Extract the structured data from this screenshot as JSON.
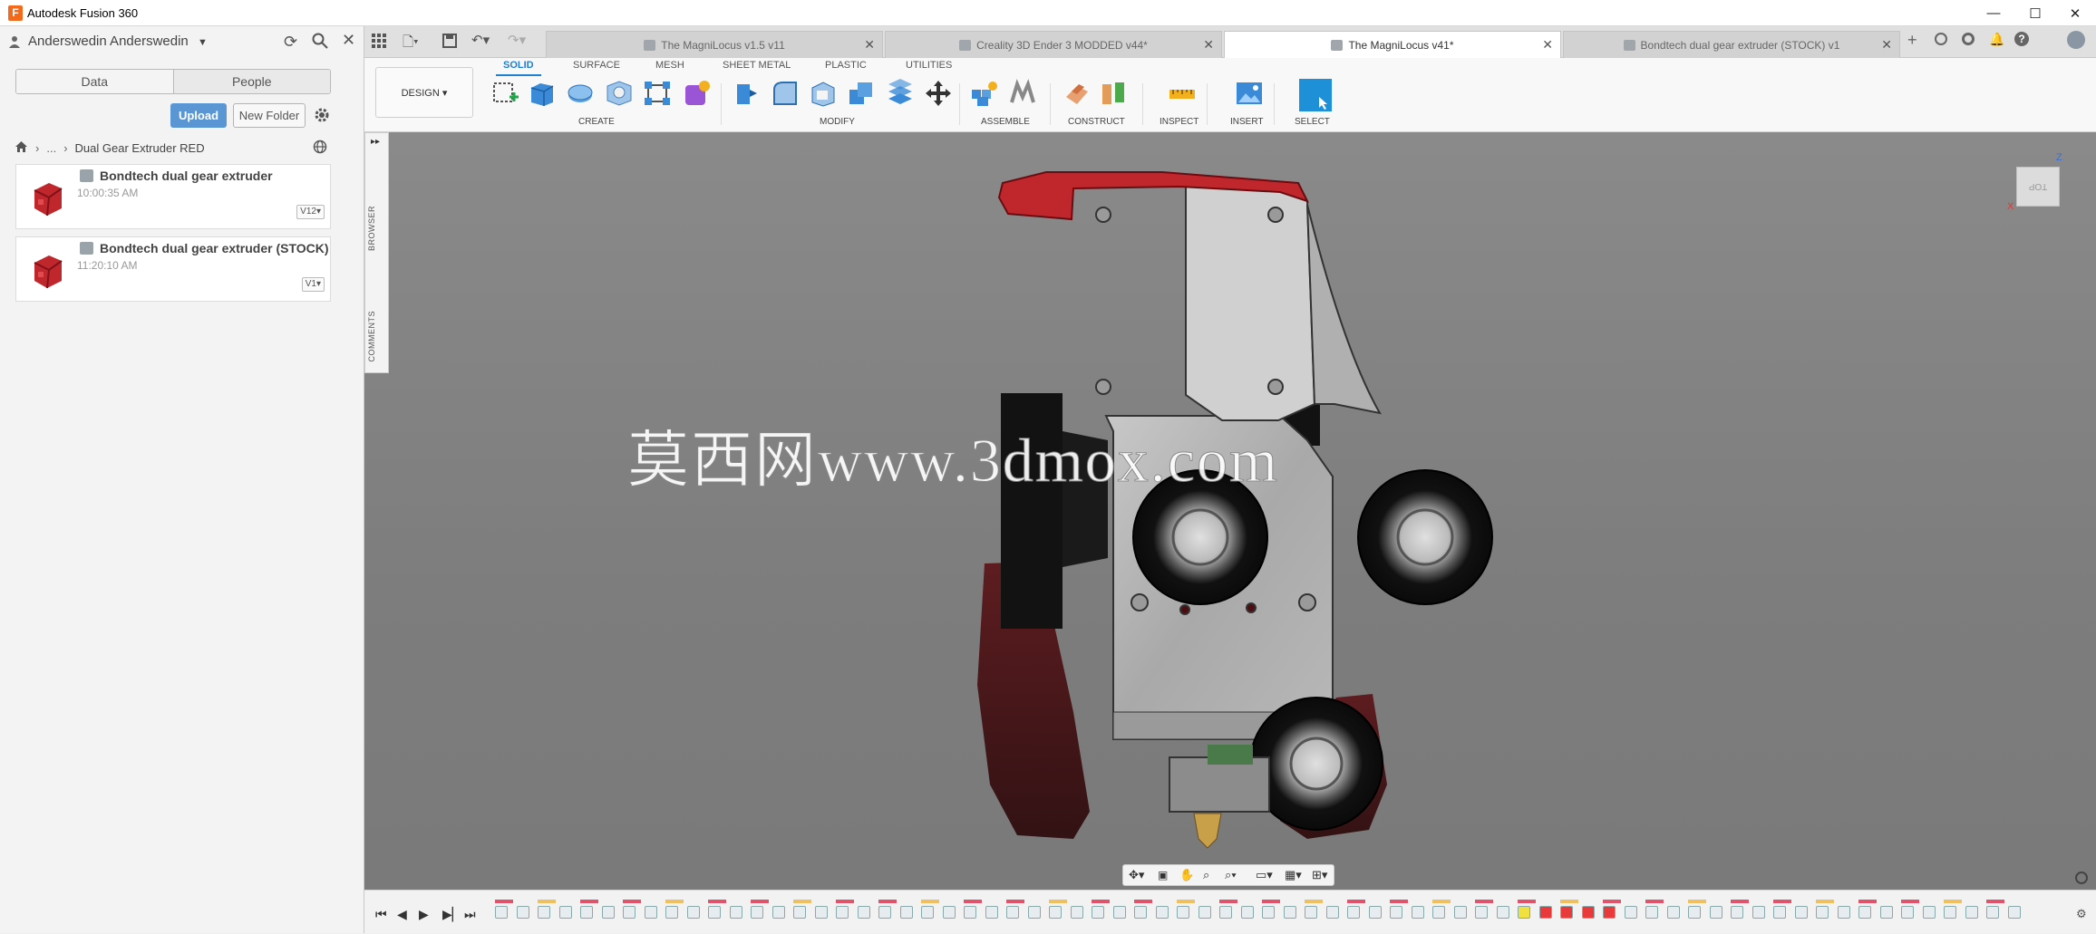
{
  "app": {
    "title": "Autodesk Fusion 360",
    "logo_letter": "F"
  },
  "window_controls": [
    "—",
    "☐",
    "✕"
  ],
  "data_panel": {
    "user": "Anderswedin Anderswedin",
    "tabs": [
      "Data",
      "People"
    ],
    "upload_label": "Upload",
    "new_folder_label": "New Folder",
    "breadcrumb_ellipsis": "...",
    "folder": "Dual Gear Extruder RED",
    "files": [
      {
        "name": "Bondtech dual gear extruder",
        "time": "10:00:35 AM",
        "version": "V12"
      },
      {
        "name": "Bondtech dual gear extruder (STOCK)",
        "time": "11:20:10 AM",
        "version": "V1"
      }
    ]
  },
  "doc_tabs": [
    {
      "label": "The MagniLocus v1.5 v11",
      "active": false
    },
    {
      "label": "Creality 3D Ender 3 MODDED v44*",
      "active": false
    },
    {
      "label": "The MagniLocus v41*",
      "active": true
    },
    {
      "label": "Bondtech dual gear extruder (STOCK) v1",
      "active": false
    }
  ],
  "toolbar": {
    "workspace": "DESIGN",
    "tabs": [
      "SOLID",
      "SURFACE",
      "MESH",
      "SHEET METAL",
      "PLASTIC",
      "UTILITIES"
    ],
    "active_tab": "SOLID",
    "groups": [
      "CREATE",
      "MODIFY",
      "ASSEMBLE",
      "CONSTRUCT",
      "INSPECT",
      "INSERT",
      "SELECT"
    ]
  },
  "viewport": {
    "browser_label": "BROWSER",
    "comments_label": "COMMENTS",
    "viewcube_face": "TOP",
    "axis_x": "X",
    "axis_z": "Z",
    "watermark": "莫西网www.3dmox.com"
  },
  "colors": {
    "accent": "#1f7fd0",
    "upload": "#5b96d4",
    "part_red": "#c0272d"
  }
}
